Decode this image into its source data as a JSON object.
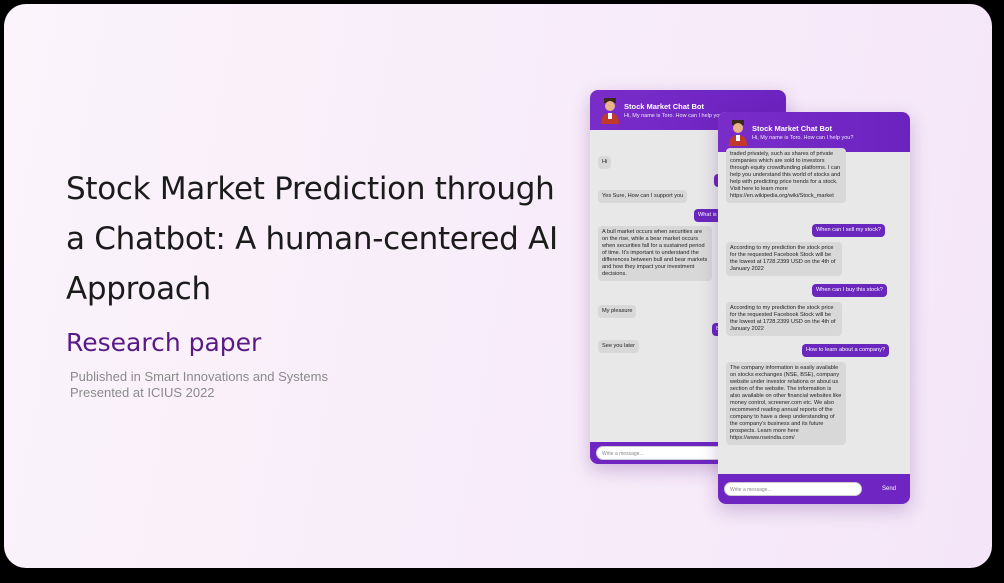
{
  "hero": {
    "title": "Stock Market Prediction through a Chatbot: A human-centered AI Approach",
    "subtitle": "Research paper",
    "meta_line1": "Published in Smart Innovations and Systems",
    "meta_line2": "Presented at ICIUS 2022"
  },
  "chat_back": {
    "bot_name": "Stock Market Chat Bot",
    "greeting": "Hi, My name is Toro. How can I help you?",
    "messages": [
      {
        "from": "bot",
        "text": "Hi"
      },
      {
        "from": "user",
        "text": "Hi"
      },
      {
        "from": "bot",
        "text": "Yes Sure, How can I support you"
      },
      {
        "from": "user",
        "text": "What is a bull market?"
      },
      {
        "from": "bot",
        "text": "A bull market occurs when securities are on the rise, while a bear market occurs when securities fall for a sustained period of time. It's important to understand the differences between bull and bear markets and how they impact your investment decisions."
      },
      {
        "from": "bot",
        "text": "My pleasure"
      },
      {
        "from": "user",
        "text": "Bye"
      },
      {
        "from": "bot",
        "text": "See you later"
      }
    ],
    "input_placeholder": "Write a message..."
  },
  "chat_front": {
    "bot_name": "Stock Market Chat Bot",
    "greeting": "Hi, My name is Toro. How can I help you?",
    "messages": [
      {
        "from": "bot",
        "text": "traded privately, such as shares of private companies which are sold to investors through equity crowdfunding platforms. I can help you understand this world of stocks and help with predicting price trends for a stock. Visit here to learn more https://en.wikipedia.org/wiki/Stock_market"
      },
      {
        "from": "user",
        "text": "When can I sell my stock?"
      },
      {
        "from": "bot",
        "text": "According to my prediction the stock price for the requested Facebook Stock will be the lowest at 1728.2399 USD on the 4th of January 2022"
      },
      {
        "from": "user",
        "text": "When can I buy this stock?"
      },
      {
        "from": "bot",
        "text": "According to my prediction the stock price for the requested Facebook Stock will be the lowest at 1728.2399 USD on the 4th of January 2022"
      },
      {
        "from": "user",
        "text": "How to learn about a company?"
      },
      {
        "from": "bot",
        "text": "The company information is easily available on stocks exchanges (NSE, BSE), company website under investor relations or about us section of the website. The information is also available on other financial websites like money control, screener.com etc. We also recommend reading annual reports of the company to have a deep understanding of the company's business and its future prospects. Learn more here https://www.nseindia.com/"
      }
    ],
    "input_placeholder": "Write a message...",
    "send_label": "Send"
  },
  "colors": {
    "brand_purple": "#6b23bf",
    "accent_text": "#5a1a86"
  }
}
